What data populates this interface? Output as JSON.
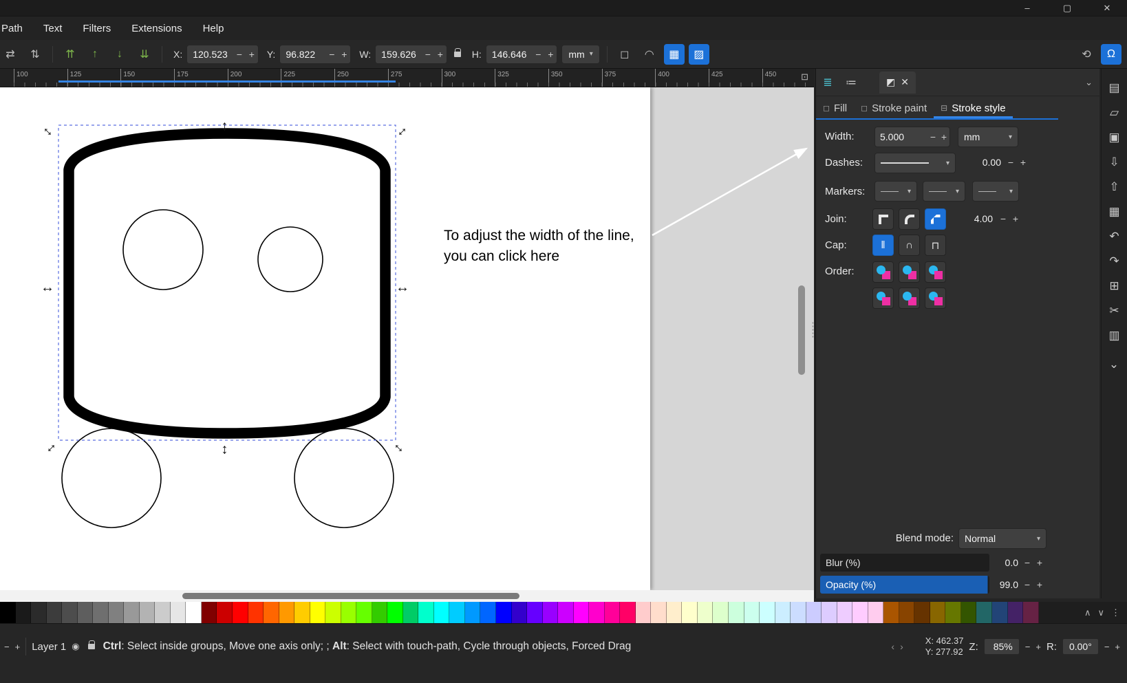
{
  "colors": {
    "accent": "#1c71d8",
    "opacity_bar": "#1a5fb4",
    "selection_dash": "#5b6ee1"
  },
  "glyphs": {
    "minus": "−",
    "plus": "+",
    "dropdown": "▾",
    "chevron_down": "⌄",
    "minimize": "–",
    "maximize": "▢",
    "close": "✕",
    "flip_h": "⇄",
    "flip_v": "⇅",
    "raise_top": "⇈",
    "raise": "↑",
    "lower": "↓",
    "lower_bottom": "⇊",
    "scale_stroke": "◻",
    "scale_corners": "◠",
    "scale_gradient": "▦",
    "scale_pattern": "▨",
    "rotate": "⟲",
    "snap": "Ω",
    "monitor": "⊡",
    "layers": "≣",
    "objects": "≔",
    "dialog": "◩",
    "eye": "◉",
    "dots": "⋮",
    "prev": "‹",
    "next": "›",
    "up": "∧",
    "down": "∨",
    "cap_butt": "‖",
    "cap_round": "∩",
    "cap_square": "⊓",
    "checkbox": "◻",
    "stroke_style_tab": "⊟",
    "handle_arrow": "↔"
  },
  "titlebar": {
    "minimize": "–",
    "maximize": "▢",
    "close": "✕"
  },
  "menu": {
    "items": [
      "Path",
      "Text",
      "Filters",
      "Extensions",
      "Help"
    ]
  },
  "toolbar": {
    "x_label": "X:",
    "x_value": "120.523",
    "y_label": "Y:",
    "y_value": "96.822",
    "w_label": "W:",
    "w_value": "159.626",
    "h_label": "H:",
    "h_value": "146.646",
    "units": "mm"
  },
  "ruler": {
    "ticks": [
      "100",
      "125",
      "150",
      "175",
      "200",
      "225",
      "250",
      "275",
      "300",
      "325",
      "350",
      "375",
      "400",
      "425",
      "450"
    ]
  },
  "canvas": {
    "annotation_line1": "To adjust the width of the line,",
    "annotation_line2": "you can click here"
  },
  "panel": {
    "tabs": {
      "fill": "Fill",
      "stroke_paint": "Stroke paint",
      "stroke_style": "Stroke style"
    },
    "width_label": "Width:",
    "width_value": "5.000",
    "width_unit": "mm",
    "dashes_label": "Dashes:",
    "dashes_value": "0.00",
    "markers_label": "Markers:",
    "join_label": "Join:",
    "join_value": "4.00",
    "cap_label": "Cap:",
    "order_label": "Order:",
    "blend_label": "Blend mode:",
    "blend_value": "Normal",
    "blur_label": "Blur (%)",
    "blur_value": "0.0",
    "opacity_label": "Opacity (%)",
    "opacity_value": "99.0"
  },
  "commands": [
    {
      "name": "document-new-icon",
      "glyph": "▤"
    },
    {
      "name": "document-open-icon",
      "glyph": "▱"
    },
    {
      "name": "document-save-icon",
      "glyph": "▣"
    },
    {
      "name": "import-icon",
      "glyph": "⇩"
    },
    {
      "name": "export-icon",
      "glyph": "⇧"
    },
    {
      "name": "print-icon",
      "glyph": "▦"
    },
    {
      "name": "undo-icon",
      "glyph": "↶"
    },
    {
      "name": "redo-icon",
      "glyph": "↷"
    },
    {
      "name": "duplicate-icon",
      "glyph": "⊞"
    },
    {
      "name": "cut-icon",
      "glyph": "✂"
    },
    {
      "name": "paste-icon",
      "glyph": "▥"
    }
  ],
  "palette": {
    "swatches": [
      "#000000",
      "#1a1a1a",
      "#2b2b2b",
      "#3c3c3c",
      "#4d4d4d",
      "#5e5e5e",
      "#6f6f6f",
      "#808080",
      "#999999",
      "#b3b3b3",
      "#cccccc",
      "#e6e6e6",
      "#ffffff",
      "#800000",
      "#cc0000",
      "#ff0000",
      "#ff3300",
      "#ff6600",
      "#ff9900",
      "#ffcc00",
      "#ffff00",
      "#ccff00",
      "#99ff00",
      "#66ff00",
      "#33cc00",
      "#00ff00",
      "#00cc66",
      "#00ffcc",
      "#00ffff",
      "#00ccff",
      "#0099ff",
      "#0066ff",
      "#0000ff",
      "#3300cc",
      "#6600ff",
      "#9900ff",
      "#cc00ff",
      "#ff00ff",
      "#ff00cc",
      "#ff0099",
      "#ff0066",
      "#ffcccc",
      "#ffddcc",
      "#ffeecc",
      "#ffffcc",
      "#eeffcc",
      "#ddffcc",
      "#ccffdd",
      "#ccffee",
      "#ccffff",
      "#cceeff",
      "#ccddff",
      "#ccccff",
      "#ddccff",
      "#eeccff",
      "#ffccff",
      "#ffccee",
      "#aa5500",
      "#884400",
      "#663300",
      "#886600",
      "#667700",
      "#335500",
      "#226666",
      "#224477",
      "#442266",
      "#662244"
    ]
  },
  "statusbar": {
    "layer": "Layer 1",
    "ctrl": "Ctrl",
    "ctrl_hint": ": Select inside groups, Move one axis only; ; ",
    "alt": "Alt",
    "alt_hint": ": Select with touch-path, Cycle through objects, Forced Drag",
    "x_label": "X:",
    "x_value": "462.37",
    "y_label": "Y:",
    "y_value": "277.92",
    "z_label": "Z:",
    "z_value": "85%",
    "r_label": "R:",
    "r_value": "0.00°"
  }
}
